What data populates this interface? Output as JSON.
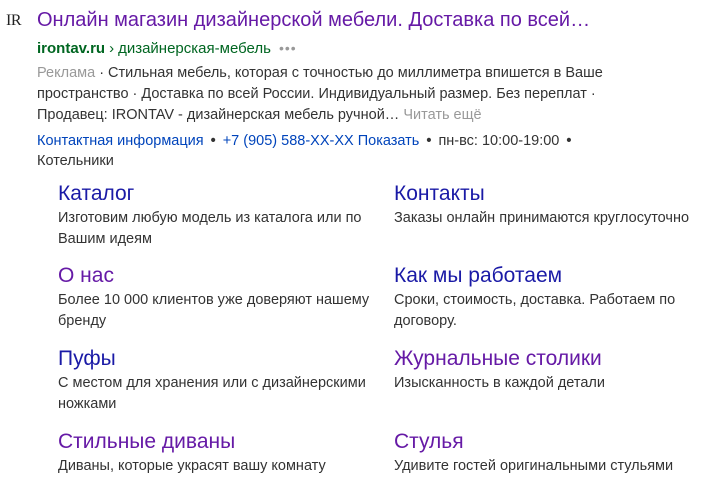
{
  "favicon": {
    "text": "IR"
  },
  "result": {
    "title": "Онлайн магазин дизайнерской мебели. Доставка по всей…",
    "domain": "irontav.ru",
    "path_separator": "›",
    "path": "дизайнерская-мебель",
    "more_icon": "•••",
    "ad_label": "Реклама",
    "snippet_line1": "· Стильная мебель, которая с точностью до миллиметра впишется в Ваше",
    "snippet_line2": "пространство · Доставка по всей России. Индивидуальный размер. Без переплат ·",
    "snippet_line3": "Продавец: IRONTAV - дизайнерская мебель ручной…",
    "read_more": "Читать ещё"
  },
  "contacts": {
    "contact_info": "Контактная информация",
    "phone": "+7 (905) 588-XX-XX Показать",
    "hours": "пн-вс: 10:00-19:00",
    "city": "Котельники",
    "separator": "•"
  },
  "sitelinks": [
    {
      "title": "Каталог",
      "desc": "Изготовим любую модель из каталога или по Вашим идеям"
    },
    {
      "title": "Контакты",
      "desc": "Заказы онлайн принимаются круглосуточно"
    },
    {
      "title": "О нас",
      "desc": "Более 10 000 клиентов уже доверяют нашему бренду"
    },
    {
      "title": "Как мы работаем",
      "desc": "Сроки, стоимость, доставка. Работаем по договору."
    },
    {
      "title": "Пуфы",
      "desc": "С местом для хранения или с дизайнерскими ножками"
    },
    {
      "title": "Журнальные столики",
      "desc": "Изысканность в каждой детали"
    },
    {
      "title": "Стильные диваны",
      "desc": "Диваны, которые украсят вашу комнату"
    },
    {
      "title": "Стулья",
      "desc": "Удивите гостей оригинальными стульями"
    }
  ],
  "colors": {
    "title_visited": "#661aa6",
    "link": "#1a1aa6",
    "domain_green": "#006621",
    "contact_link": "#0044bb",
    "muted": "#999999"
  }
}
